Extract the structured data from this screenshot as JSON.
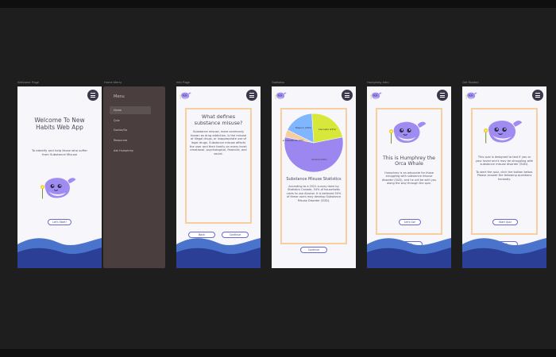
{
  "frames": [
    {
      "label": "Welcome Page",
      "title": "Welcome To New Habits Web App",
      "subtitle": "To identify and help those who suffer from Substance Misuse",
      "button": "Let's Start!"
    },
    {
      "label": "Home Menu",
      "menu_title": "Menu",
      "items": [
        "Home",
        "Quiz",
        "Doctor/Go",
        "Resources",
        "Ask Humphrey"
      ]
    },
    {
      "label": "Info Page",
      "heading": "What defines substance misuse?",
      "body": "Substance misuse, more commonly known as drug addiction, is the misuse of illegal drugs, or inappropriate use of legal drugs. Substance misuse affects the user and their family on every level: emotional, psychological, financial, and social.",
      "back_button": "Back",
      "continue_button": "Continue"
    },
    {
      "label": "Statistics",
      "title": "Substance Misuse Statistics",
      "body": "According to a 2021 survey done by Statistics Canada, 54% of households claim to use Alcohol. It is believed 50% of these users may develop Substance Misuse Disorder (SUD).",
      "continue_button": "Continue"
    },
    {
      "label": "Humphrey Intro",
      "title": "This is Humphrey the Orca Whale",
      "body": "Humphrey is an advocate for those struggling with substance misuse disorder (SUD), and he will be with you along the way through the quiz.",
      "lets_go_button": "Let's Go!",
      "back_button": "Back"
    },
    {
      "label": "Get Started",
      "body1": "This quiz is designed to test if you or your loved one's may be struggling with substance misuse disorder (SUD).",
      "body2": "To start the quiz, click the button below. Please answer the following questions honestly.",
      "start_button": "Start Quiz",
      "back_button": "Back"
    }
  ],
  "chart_data": {
    "type": "pie",
    "title": "",
    "series": [
      {
        "name": "Alcohol (54%)",
        "value": 54,
        "color": "#9b87ef"
      },
      {
        "name": "Illegal Substances (4%)",
        "value": 4,
        "color": "#f5cfa0"
      },
      {
        "name": "Tobacco (16%)",
        "value": 16,
        "color": "#7fb6ff"
      },
      {
        "name": "Cannabis (22%)",
        "value": 22,
        "color": "#d7e83a"
      }
    ]
  },
  "colors": {
    "wave_dark": "#2b3f96",
    "wave_light": "#4a74cc",
    "accent": "#9b87ef",
    "card_border": "#f5cfa0"
  }
}
